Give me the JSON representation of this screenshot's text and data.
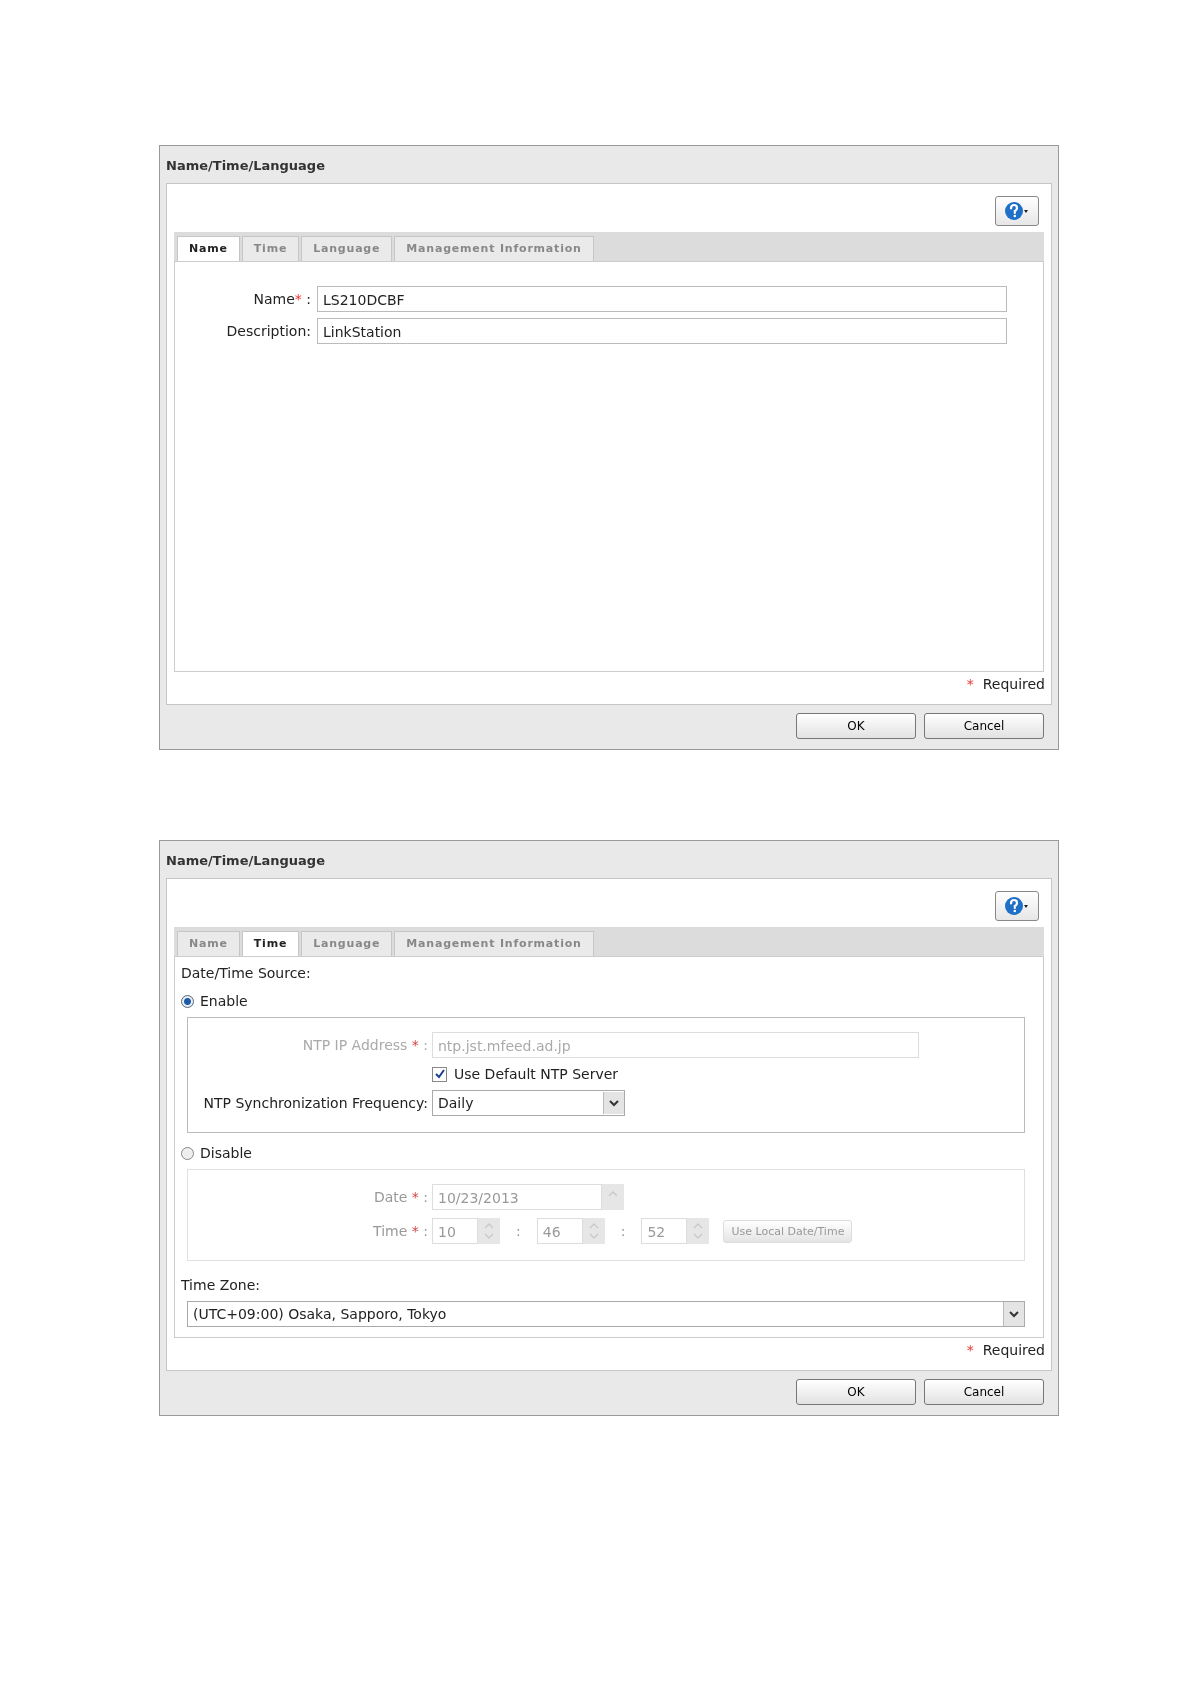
{
  "dialogs": [
    {
      "title": "Name/Time/Language",
      "kind": "name",
      "tabs": [
        {
          "label": "Name",
          "selected": true
        },
        {
          "label": "Time",
          "selected": false
        },
        {
          "label": "Language",
          "selected": false
        },
        {
          "label": "Management Information",
          "selected": false
        }
      ],
      "fields": [
        {
          "label": "Name",
          "mark": "*",
          "colon": ":",
          "value": "LS210DCBF"
        },
        {
          "label": "Description:",
          "value": "LinkStation"
        }
      ],
      "required_mark": "*",
      "required_note": "Required",
      "buttons": [
        "OK",
        "Cancel"
      ]
    },
    {
      "title": "Name/Time/Language",
      "kind": "time",
      "tabs": [
        {
          "label": "Name",
          "selected": false
        },
        {
          "label": "Time",
          "selected": true
        },
        {
          "label": "Language",
          "selected": false
        },
        {
          "label": "Management Information",
          "selected": false
        }
      ],
      "source_label": "Date/Time Source:",
      "options": [
        {
          "label": "Enable",
          "selected": true
        },
        {
          "label": "Disable",
          "selected": false
        }
      ],
      "ntp_address": {
        "label": "NTP IP Address",
        "mark": "*",
        "colon": ":",
        "value": "ntp.jst.mfeed.ad.jp"
      },
      "use_default": {
        "label": "Use Default NTP Server",
        "checked": true
      },
      "frequency": {
        "label": "NTP Synchronization Frequency:",
        "value": "Daily"
      },
      "date": {
        "label": "Date",
        "mark": "*",
        "colon": ":",
        "value": "10/23/2013"
      },
      "time": {
        "label": "Time",
        "mark": "*",
        "colon": ":",
        "hour": "10",
        "minute": "46",
        "second": "52",
        "separators": [
          ":",
          ":"
        ]
      },
      "local_button": "Use Local Date/Time",
      "zone_label": "Time Zone:",
      "zone_value": "(UTC+09:00) Osaka, Sapporo, Tokyo",
      "required_mark": "*",
      "required_note": "Required",
      "buttons": [
        "OK",
        "Cancel"
      ]
    }
  ]
}
